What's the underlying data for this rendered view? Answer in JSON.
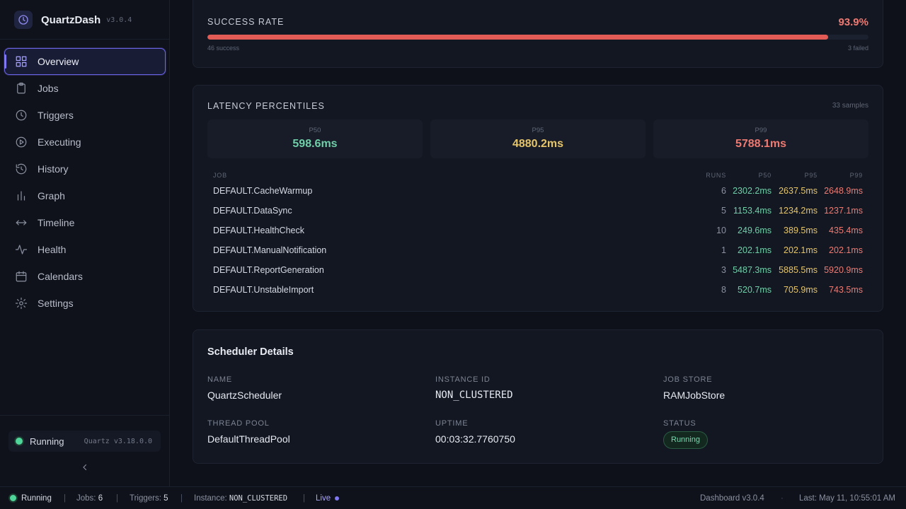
{
  "app": {
    "name": "QuartzDash",
    "version": "v3.0.4"
  },
  "sidebar": {
    "items": [
      {
        "label": "Overview",
        "icon": "grid-icon",
        "active": true
      },
      {
        "label": "Jobs",
        "icon": "clipboard-icon"
      },
      {
        "label": "Triggers",
        "icon": "clock-icon"
      },
      {
        "label": "Executing",
        "icon": "play-circle-icon"
      },
      {
        "label": "History",
        "icon": "history-icon"
      },
      {
        "label": "Graph",
        "icon": "bar-chart-icon"
      },
      {
        "label": "Timeline",
        "icon": "arrows-horizontal-icon"
      },
      {
        "label": "Health",
        "icon": "activity-icon"
      },
      {
        "label": "Calendars",
        "icon": "calendar-icon"
      },
      {
        "label": "Settings",
        "icon": "gear-icon"
      }
    ],
    "status_label": "Running",
    "quartz_version": "Quartz v3.18.0.0"
  },
  "success_rate": {
    "title": "SUCCESS RATE",
    "value_text": "93.9%",
    "value": 0.939,
    "success_text": "46 success",
    "failed_text": "3 failed"
  },
  "latency": {
    "title": "LATENCY PERCENTILES",
    "samples_text": "33 samples",
    "summary": [
      {
        "label": "P50",
        "value": "598.6ms",
        "color": "#6fcfa8"
      },
      {
        "label": "P95",
        "value": "4880.2ms",
        "color": "#e6c569"
      },
      {
        "label": "P99",
        "value": "5788.1ms",
        "color": "#ee7a72"
      }
    ],
    "columns": {
      "job": "JOB",
      "runs": "RUNS",
      "p50": "P50",
      "p95": "P95",
      "p99": "P99"
    },
    "rows": [
      {
        "job": "DEFAULT.CacheWarmup",
        "runs": "6",
        "p50": "2302.2ms",
        "p95": "2637.5ms",
        "p99": "2648.9ms"
      },
      {
        "job": "DEFAULT.DataSync",
        "runs": "5",
        "p50": "1153.4ms",
        "p95": "1234.2ms",
        "p99": "1237.1ms"
      },
      {
        "job": "DEFAULT.HealthCheck",
        "runs": "10",
        "p50": "249.6ms",
        "p95": "389.5ms",
        "p99": "435.4ms"
      },
      {
        "job": "DEFAULT.ManualNotification",
        "runs": "1",
        "p50": "202.1ms",
        "p95": "202.1ms",
        "p99": "202.1ms"
      },
      {
        "job": "DEFAULT.ReportGeneration",
        "runs": "3",
        "p50": "5487.3ms",
        "p95": "5885.5ms",
        "p99": "5920.9ms"
      },
      {
        "job": "DEFAULT.UnstableImport",
        "runs": "8",
        "p50": "520.7ms",
        "p95": "705.9ms",
        "p99": "743.5ms"
      }
    ]
  },
  "scheduler": {
    "title": "Scheduler Details",
    "name_label": "NAME",
    "name": "QuartzScheduler",
    "instance_label": "INSTANCE ID",
    "instance": "NON_CLUSTERED",
    "store_label": "JOB STORE",
    "store": "RAMJobStore",
    "pool_label": "THREAD POOL",
    "pool": "DefaultThreadPool",
    "uptime_label": "UPTIME",
    "uptime": "00:03:32.7760750",
    "status_label": "STATUS",
    "status": "Running"
  },
  "statusbar": {
    "running": "Running",
    "jobs_label": "Jobs:",
    "jobs": "6",
    "triggers_label": "Triggers:",
    "triggers": "5",
    "instance_label": "Instance:",
    "instance": "NON_CLUSTERED",
    "live": "Live",
    "dashboard": "Dashboard v3.0.4",
    "sep": "|",
    "dot_sep": "·",
    "last_update": "Last: May 11, 10:55:01 AM"
  }
}
